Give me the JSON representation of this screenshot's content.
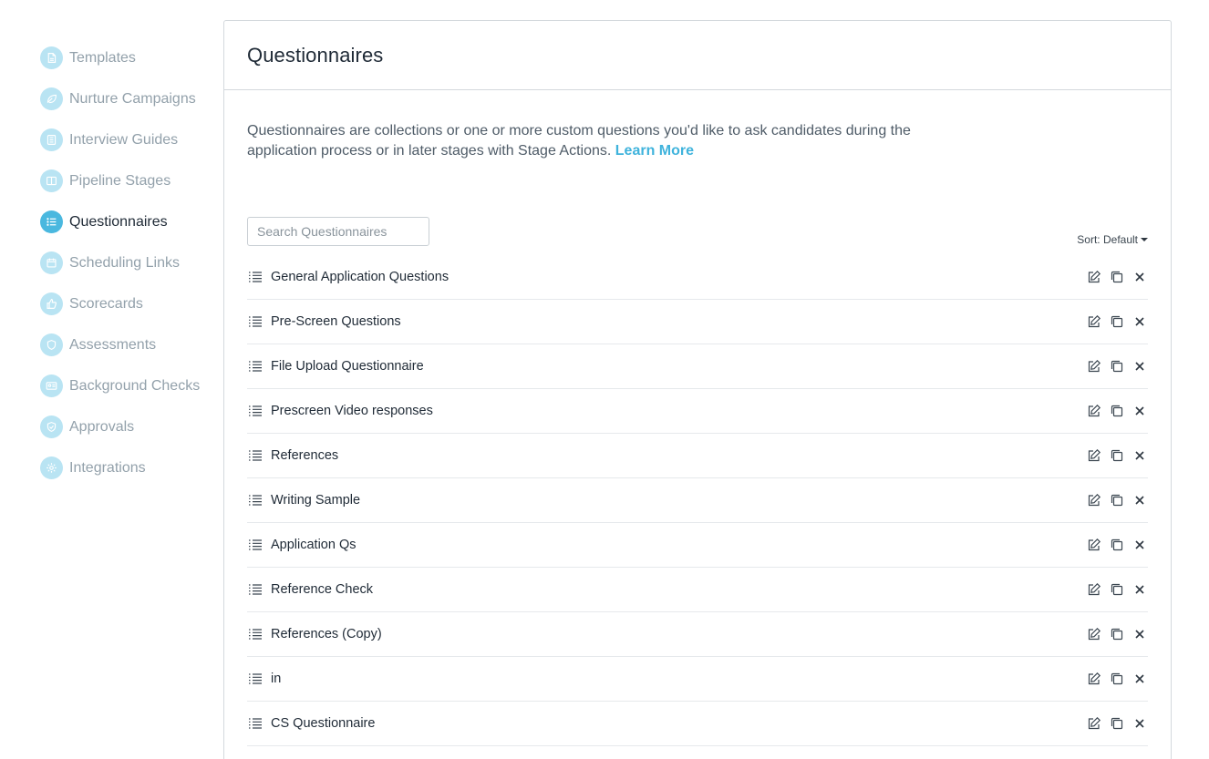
{
  "sidebar": {
    "items": [
      {
        "label": "Templates",
        "icon": "document-icon",
        "active": false
      },
      {
        "label": "Nurture Campaigns",
        "icon": "leaf-icon",
        "active": false
      },
      {
        "label": "Interview Guides",
        "icon": "guide-icon",
        "active": false
      },
      {
        "label": "Pipeline Stages",
        "icon": "columns-icon",
        "active": false
      },
      {
        "label": "Questionnaires",
        "icon": "list-icon",
        "active": true
      },
      {
        "label": "Scheduling Links",
        "icon": "calendar-icon",
        "active": false
      },
      {
        "label": "Scorecards",
        "icon": "thumbs-up-icon",
        "active": false
      },
      {
        "label": "Assessments",
        "icon": "shield-icon",
        "active": false
      },
      {
        "label": "Background Checks",
        "icon": "id-card-icon",
        "active": false
      },
      {
        "label": "Approvals",
        "icon": "check-shield-icon",
        "active": false
      },
      {
        "label": "Integrations",
        "icon": "gear-icon",
        "active": false
      }
    ]
  },
  "main": {
    "title": "Questionnaires",
    "description": "Questionnaires are collections or one or more custom questions you'd like to ask candidates during the application process or in later stages with Stage Actions.",
    "learn_more": "Learn More",
    "search_placeholder": "Search Questionnaires",
    "sort_label": "Sort: Default",
    "questionnaires": [
      "General Application Questions",
      "Pre-Screen Questions",
      "File Upload Questionnaire",
      "Prescreen Video responses",
      "References",
      "Writing Sample",
      "Application Qs",
      "Reference Check",
      "References (Copy)",
      "in",
      "CS Questionnaire"
    ]
  },
  "colors": {
    "accent": "#4ab8df",
    "icon_inactive_bg": "#b9e4f3",
    "link": "#3fb3dc"
  }
}
